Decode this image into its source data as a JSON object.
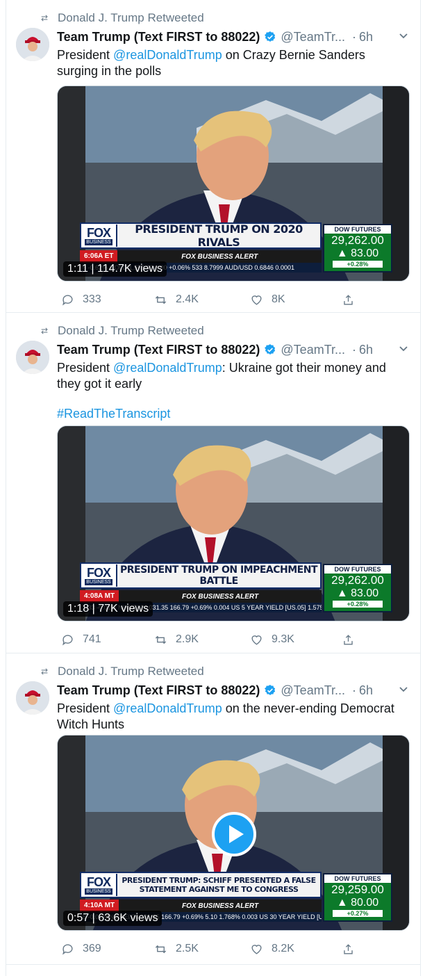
{
  "tweets": [
    {
      "retweet_label": "Donald J. Trump Retweeted",
      "author": {
        "name": "Team Trump (Text FIRST to 88022)",
        "handle": "@TeamTr...",
        "dot": "·",
        "time": "6h"
      },
      "text": {
        "before": "President ",
        "mention": "@realDonaldTrump",
        "after": " on Crazy Bernie Sanders surging in the polls",
        "hashtag": ""
      },
      "video": {
        "duration": "1:11",
        "views": "114.7K views",
        "banner": "PRESIDENT TRUMP ON 2020 RIVALS",
        "strip_time": "6:06A ET",
        "network": "FOX BUSINESS ALERT",
        "ticker": "6  -0.62%  GOLD  1,558.90  1.00  +0.06%   533  8.7999  AUD/USD 0.6846  0.0001",
        "dow_label": "DOW FUTURES",
        "dow_value": "29,262.00",
        "dow_change": "▲ 83.00",
        "dow_pct": "+0.28%",
        "play_button": false
      },
      "actions": {
        "replies": "333",
        "retweets": "2.4K",
        "likes": "8K"
      }
    },
    {
      "retweet_label": "Donald J. Trump Retweeted",
      "author": {
        "name": "Team Trump (Text FIRST to 88022)",
        "handle": "@TeamTr...",
        "dot": "·",
        "time": "6h"
      },
      "text": {
        "before": "President ",
        "mention": "@realDonaldTrump",
        "after": ": Ukraine got their money and they got it early",
        "hashtag": "#ReadTheTranscript"
      },
      "video": {
        "duration": "1:18",
        "views": "77K views",
        "banner": "PRESIDENT TRUMP ON IMPEACHMENT BATTLE",
        "strip_time": "4:08A MT",
        "network": "FOX BUSINESS ALERT",
        "ticker": "1.33  -0.01%  NIKKEI  24,031.35  166.79  +0.69%   0.004  US 5 YEAR YIELD [US.05]  1.575%  0.0",
        "dow_label": "DOW FUTURES",
        "dow_value": "29,262.00",
        "dow_change": "▲ 83.00",
        "dow_pct": "+0.28%",
        "play_button": false
      },
      "actions": {
        "replies": "741",
        "retweets": "2.9K",
        "likes": "9.3K"
      }
    },
    {
      "retweet_label": "Donald J. Trump Retweeted",
      "author": {
        "name": "Team Trump (Text FIRST to 88022)",
        "handle": "@TeamTr...",
        "dot": "·",
        "time": "6h"
      },
      "text": {
        "before": "President ",
        "mention": "@realDonaldTrump",
        "after": " on the never-ending Democrat Witch Hunts",
        "hashtag": ""
      },
      "video": {
        "duration": "0:57",
        "views": "63.6K views",
        "banner": "PRESIDENT TRUMP: SCHIFF PRESENTED A FALSE STATEMENT AGAINST ME TO CONGRESS",
        "strip_time": "4:10A MT",
        "network": "FOX BUSINESS ALERT",
        "ticker": "5  -0.01%  NIKKEI  24,031.35  166.79  +0.69%   5.10  1.768%  0.003  US 30 YEAR YIELD [US",
        "dow_label": "DOW FUTURES",
        "dow_value": "29,259.00",
        "dow_change": "▲ 80.00",
        "dow_pct": "+0.27%",
        "play_button": true
      },
      "actions": {
        "replies": "369",
        "retweets": "2.5K",
        "likes": "8.2K"
      }
    }
  ],
  "brand": {
    "fox_logo": "FOX",
    "fox_sub": "BUSINESS"
  },
  "colors": {
    "link": "#1b95e0",
    "muted": "#657786",
    "verified": "#1da1f2",
    "fox_navy": "#0f2a5e",
    "dow_green": "#0c7a2a"
  }
}
